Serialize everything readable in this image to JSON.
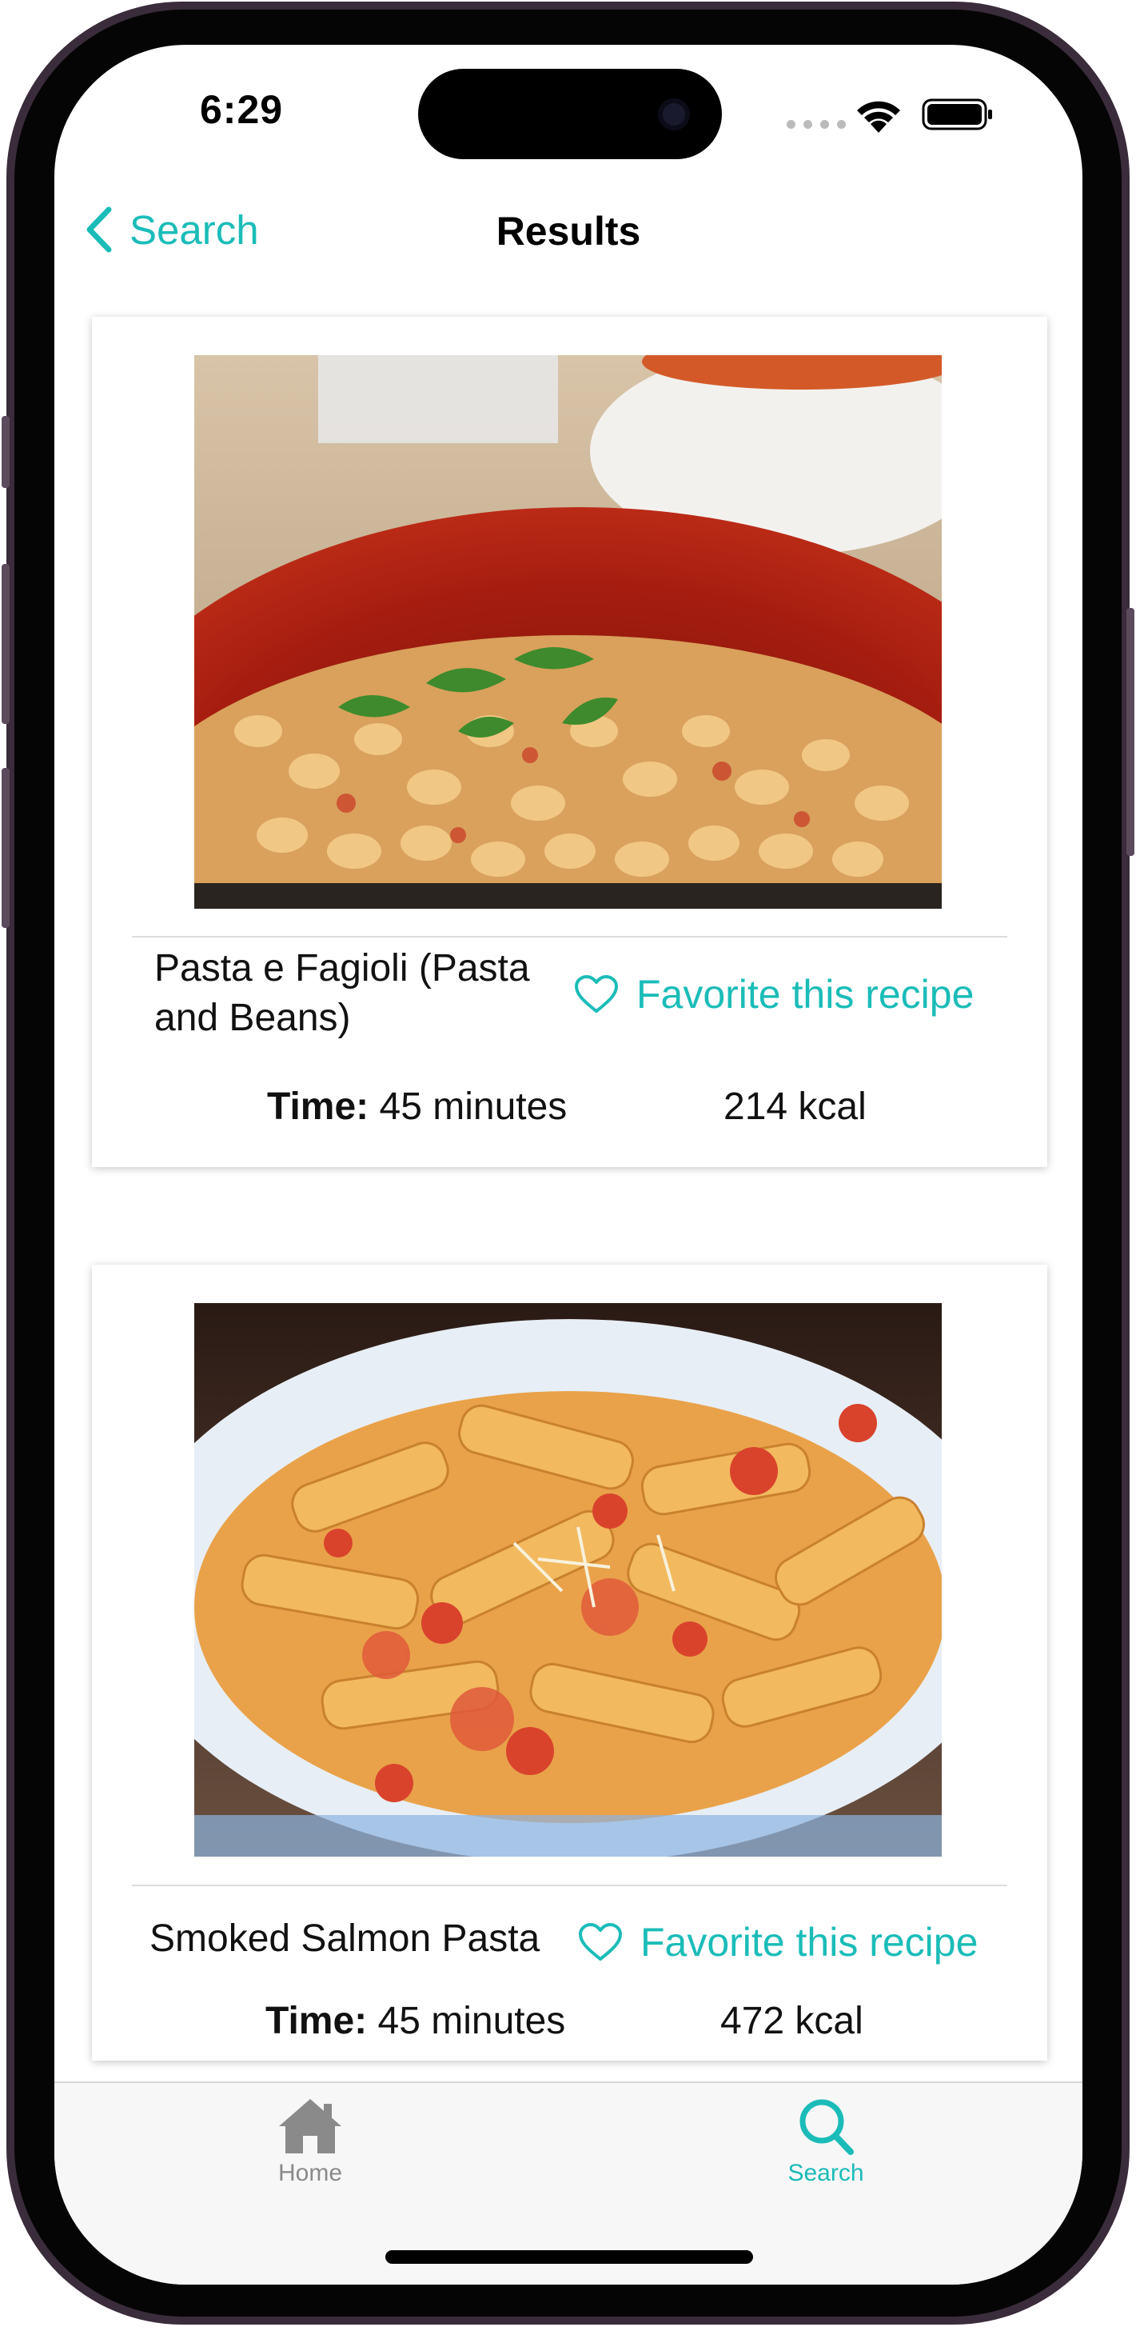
{
  "status_bar": {
    "time": "6:29"
  },
  "nav": {
    "back_label": "Search",
    "title": "Results"
  },
  "recipes": [
    {
      "title_line1": "Pasta e Fagioli (Pasta",
      "title_line2": "and Beans)",
      "favorite_label": "Favorite this recipe",
      "time_label": "Time:",
      "time_value": "45 minutes",
      "calories": "214 kcal"
    },
    {
      "title_line1": "Smoked Salmon Pasta",
      "favorite_label": "Favorite this recipe",
      "time_label": "Time:",
      "time_value": "45 minutes",
      "calories": "472 kcal"
    }
  ],
  "tab_bar": {
    "items": [
      {
        "label": "Home",
        "icon": "house-icon",
        "active": false
      },
      {
        "label": "Search",
        "icon": "magnifier-icon",
        "active": true
      }
    ]
  },
  "colors": {
    "accent": "#1bbcb8",
    "inactive_tab": "#8a8a8a"
  }
}
